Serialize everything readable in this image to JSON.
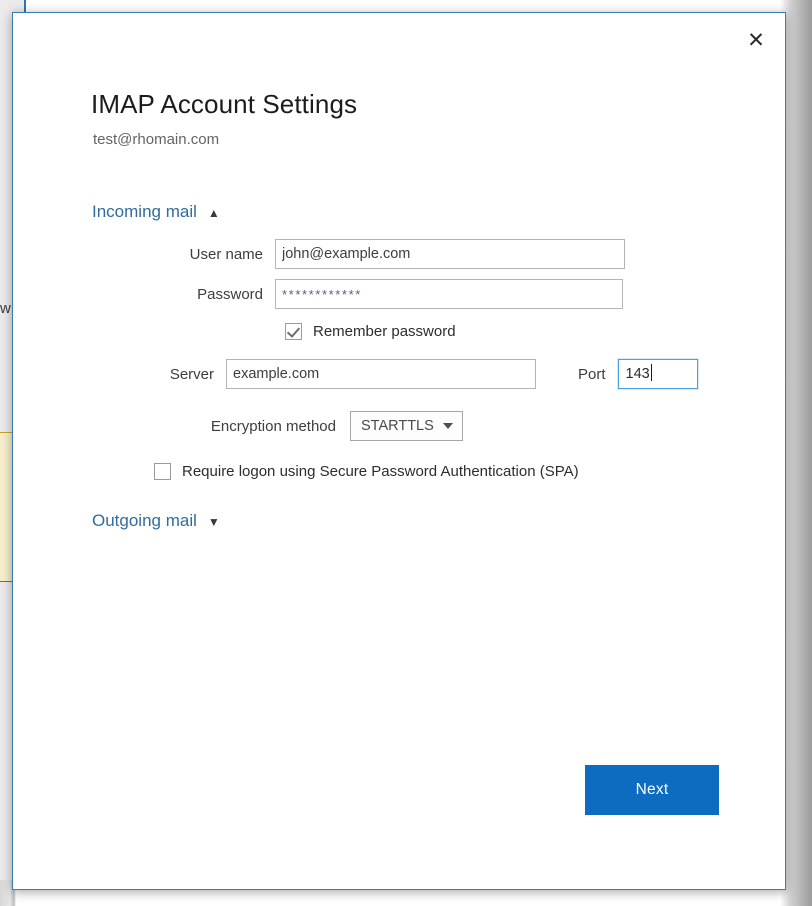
{
  "dialog": {
    "title": "IMAP Account Settings",
    "account_email": "test@rhomain.com",
    "close_icon": "close-icon",
    "accent_color": "#0d6cbf",
    "link_color": "#2f6d9e",
    "border_color": "#3a7cb8"
  },
  "sections": {
    "incoming": {
      "label": "Incoming mail",
      "chevron": "⌃",
      "expanded": true
    },
    "outgoing": {
      "label": "Outgoing mail",
      "chevron": "⌄",
      "expanded": false
    }
  },
  "form": {
    "username": {
      "label": "User name",
      "value": "john@example.com"
    },
    "password": {
      "label": "Password",
      "value": "************"
    },
    "remember_password": {
      "label": "Remember password",
      "checked": true
    },
    "server": {
      "label": "Server",
      "value": "example.com"
    },
    "port": {
      "label": "Port",
      "value": "143",
      "focused": true
    },
    "encryption": {
      "label": "Encryption method",
      "value": "STARTTLS",
      "arrow_icon": "chevron-down-icon"
    },
    "spa": {
      "label": "Require logon using Secure Password Authentication (SPA)",
      "checked": false
    }
  },
  "actions": {
    "next_label": "Next"
  },
  "background": {
    "text_fragment": "w"
  }
}
